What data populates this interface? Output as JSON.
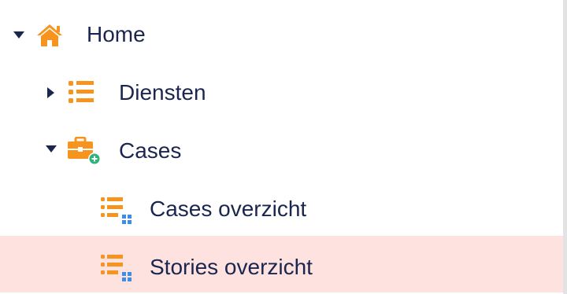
{
  "tree": {
    "items": [
      {
        "label": "Home",
        "icon": "home-icon",
        "expanded": true
      },
      {
        "label": "Diensten",
        "icon": "list-icon",
        "expanded": false
      },
      {
        "label": "Cases",
        "icon": "briefcase-add-icon",
        "expanded": true
      },
      {
        "label": "Cases overzicht",
        "icon": "list-grid-icon"
      },
      {
        "label": "Stories overzicht",
        "icon": "list-grid-icon",
        "selected": true
      }
    ]
  },
  "colors": {
    "accent_orange": "#f7941d",
    "text_navy": "#1b264f",
    "selected_row_bg": "#fde2e0",
    "badge_green": "#2db37b",
    "grid_blue": "#3d8ee8"
  }
}
